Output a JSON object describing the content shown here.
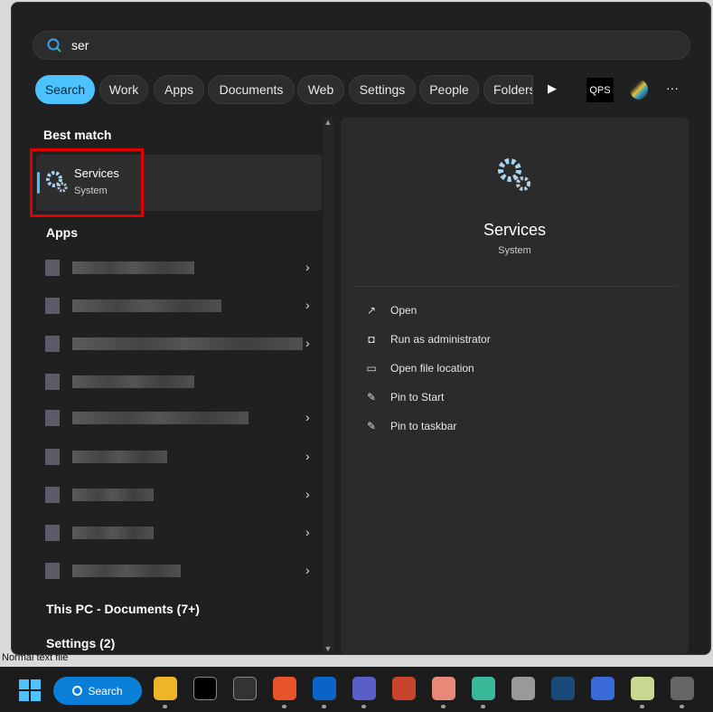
{
  "search": {
    "query": "ser"
  },
  "filters": [
    {
      "label": "Search",
      "active": true
    },
    {
      "label": "Work"
    },
    {
      "label": "Apps"
    },
    {
      "label": "Documents"
    },
    {
      "label": "Web"
    },
    {
      "label": "Settings"
    },
    {
      "label": "People"
    },
    {
      "label": "Folders"
    }
  ],
  "toolbar": {
    "qps_label": "QPS",
    "more": "···",
    "next": "▶"
  },
  "sections": {
    "best_match": "Best match",
    "apps": "Apps",
    "documents": "This PC - Documents (7+)",
    "settings": "Settings (2)"
  },
  "best_match": {
    "title": "Services",
    "subtitle": "System",
    "highlight_color": "#e00000"
  },
  "detail": {
    "title": "Services",
    "subtitle": "System",
    "actions": [
      {
        "label": "Open",
        "icon": "open-external-icon"
      },
      {
        "label": "Run as administrator",
        "icon": "shield-admin-icon"
      },
      {
        "label": "Open file location",
        "icon": "folder-icon"
      },
      {
        "label": "Pin to Start",
        "icon": "pin-icon"
      },
      {
        "label": "Pin to taskbar",
        "icon": "pin-icon"
      }
    ]
  },
  "status_text": "Normal text file",
  "taskbar": {
    "search_label": "Search",
    "apps": [
      "File Explorer",
      "Command Prompt",
      "Terminal",
      "Firefox",
      "Outlook",
      "Teams",
      "PowerPoint",
      "App",
      "App",
      "App",
      "App",
      "Remote Desktop",
      "Notepad++",
      "Database"
    ]
  },
  "colors": {
    "accent": "#4cc2ff",
    "panel": "#202020",
    "detail": "#2b2b2b"
  }
}
